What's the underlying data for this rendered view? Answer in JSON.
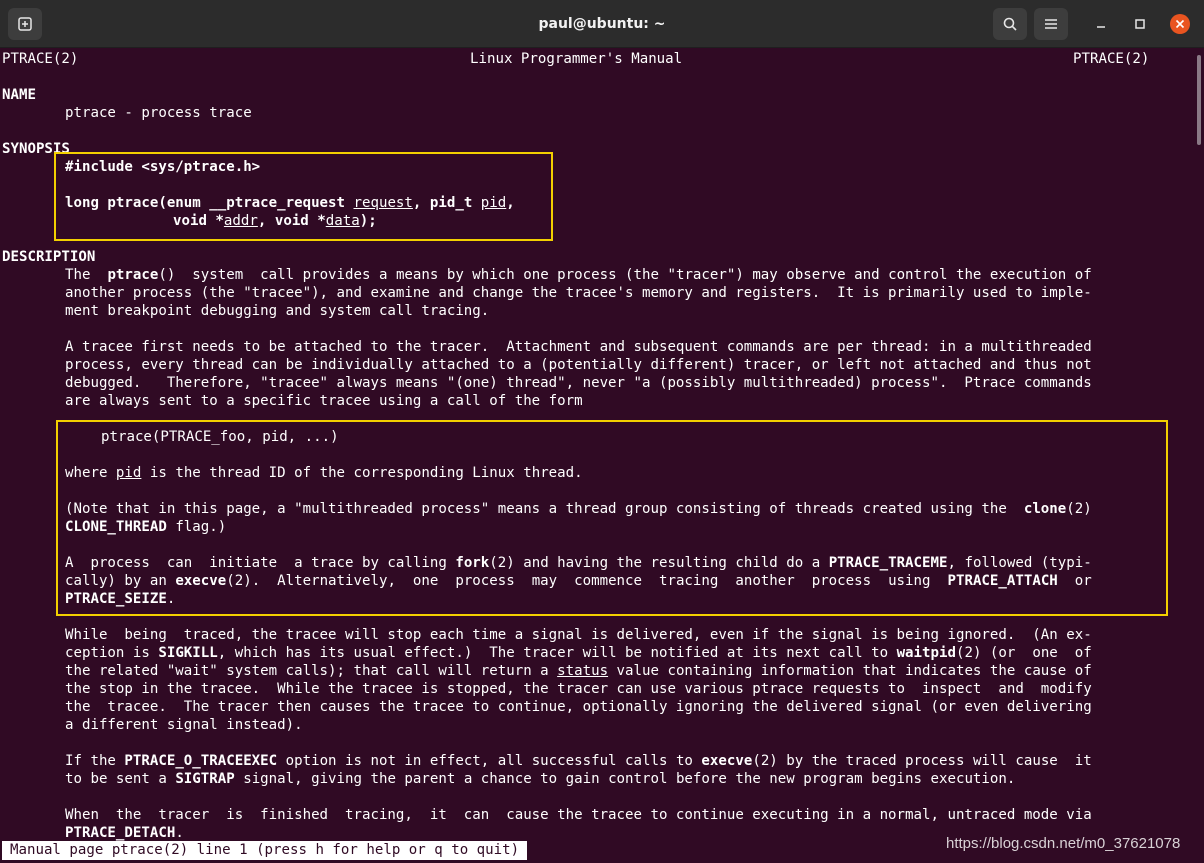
{
  "window": {
    "title": "paul@ubuntu: ~"
  },
  "manpage": {
    "header_left": "PTRACE(2)",
    "header_center": "Linux Programmer's Manual",
    "header_right": "PTRACE(2)",
    "section_name": "NAME",
    "name_desc": "ptrace - process trace",
    "section_synopsis": "SYNOPSIS",
    "include": "#include <sys/ptrace.h>",
    "sig1_a": "long ptrace(enum __ptrace_request ",
    "sig1_b": "request",
    "sig1_c": ", pid_t ",
    "sig1_d": "pid",
    "sig1_e": ",",
    "sig2_a": "void *",
    "sig2_b": "addr",
    "sig2_c": ", void *",
    "sig2_d": "data",
    "sig2_e": ");",
    "section_description": "DESCRIPTION",
    "d1_l1_a": "The  ",
    "d1_l1_b": "ptrace",
    "d1_l1_c": "()  system  call provides a means by which one process (the \"tracer\") may observe and control the execution of",
    "d1_l2": "another process (the \"tracee\"), and examine and change the tracee's memory and registers.  It is primarily used to imple‐",
    "d1_l3": "ment breakpoint debugging and system call tracing.",
    "d2_l1": "A tracee first needs to be attached to the tracer.  Attachment and subsequent commands are per thread: in a multithreaded",
    "d2_l2": "process, every thread can be individually attached to a (potentially different) tracer, or left not attached and thus not",
    "d2_l3": "debugged.   Therefore, \"tracee\" always means \"(one) thread\", never \"a (possibly multithreaded) process\".  Ptrace commands",
    "d2_l4": "are always sent to a specific tracee using a call of the form",
    "call_form": "ptrace(PTRACE_foo, pid, ...)",
    "where_a": "where ",
    "where_b": "pid",
    "where_c": " is the thread ID of the corresponding Linux thread.",
    "note_l1_a": "(Note that in this page, a \"multithreaded process\" means a thread group consisting of threads created using the  ",
    "note_l1_b": "clone",
    "note_l1_c": "(2)",
    "note_l2_a": "CLONE_THREAD",
    "note_l2_b": " flag.)",
    "init_l1_a": "A  process  can  initiate  a trace by calling ",
    "init_l1_b": "fork",
    "init_l1_c": "(2) and having the resulting child do a ",
    "init_l1_d": "PTRACE_TRACEME",
    "init_l1_e": ", followed (typi‐",
    "init_l2_a": "cally) by an ",
    "init_l2_b": "execve",
    "init_l2_c": "(2).  Alternatively,  one  process  may  commence  tracing  another  process  using  ",
    "init_l2_d": "PTRACE_ATTACH",
    "init_l2_e": "  or",
    "init_l3_a": "PTRACE_SEIZE",
    "init_l3_b": ".",
    "w_l1": "While  being  traced, the tracee will stop each time a signal is delivered, even if the signal is being ignored.  (An ex‐",
    "w_l2_a": "ception is ",
    "w_l2_b": "SIGKILL",
    "w_l2_c": ", which has its usual effect.)  The tracer will be notified at its next call to ",
    "w_l2_d": "waitpid",
    "w_l2_e": "(2) (or  one  of",
    "w_l3_a": "the related \"wait\" system calls); that call will return a ",
    "w_l3_b": "status",
    "w_l3_c": " value containing information that indicates the cause of",
    "w_l4": "the stop in the tracee.  While the tracee is stopped, the tracer can use various ptrace requests to  inspect  and  modify",
    "w_l5": "the  tracee.  The tracer then causes the tracee to continue, optionally ignoring the delivered signal (or even delivering",
    "w_l6": "a different signal instead).",
    "x_l1_a": "If the ",
    "x_l1_b": "PTRACE_O_TRACEEXEC",
    "x_l1_c": " option is not in effect, all successful calls to ",
    "x_l1_d": "execve",
    "x_l1_e": "(2) by the traced process will cause  it",
    "x_l2_a": "to be sent a ",
    "x_l2_b": "SIGTRAP",
    "x_l2_c": " signal, giving the parent a chance to gain control before the new program begins execution.",
    "f_l1": "When  the  tracer  is  finished  tracing,  it  can  cause the tracee to continue executing in a normal, untraced mode via",
    "f_l2_a": "PTRACE_DETACH",
    "f_l2_b": "."
  },
  "status": {
    "text": "Manual page ptrace(2) line 1 (press h for help or q to quit)"
  },
  "watermark": "https://blog.csdn.net/m0_37621078",
  "colors": {
    "terminal_bg": "#300a24",
    "titlebar_bg": "#2c2c2c",
    "highlight_box": "#f2d000",
    "close_button": "#e95420"
  },
  "icons": [
    "new-tab-icon",
    "search-icon",
    "hamburger-menu-icon",
    "minimize-icon",
    "maximize-icon",
    "close-icon"
  ]
}
